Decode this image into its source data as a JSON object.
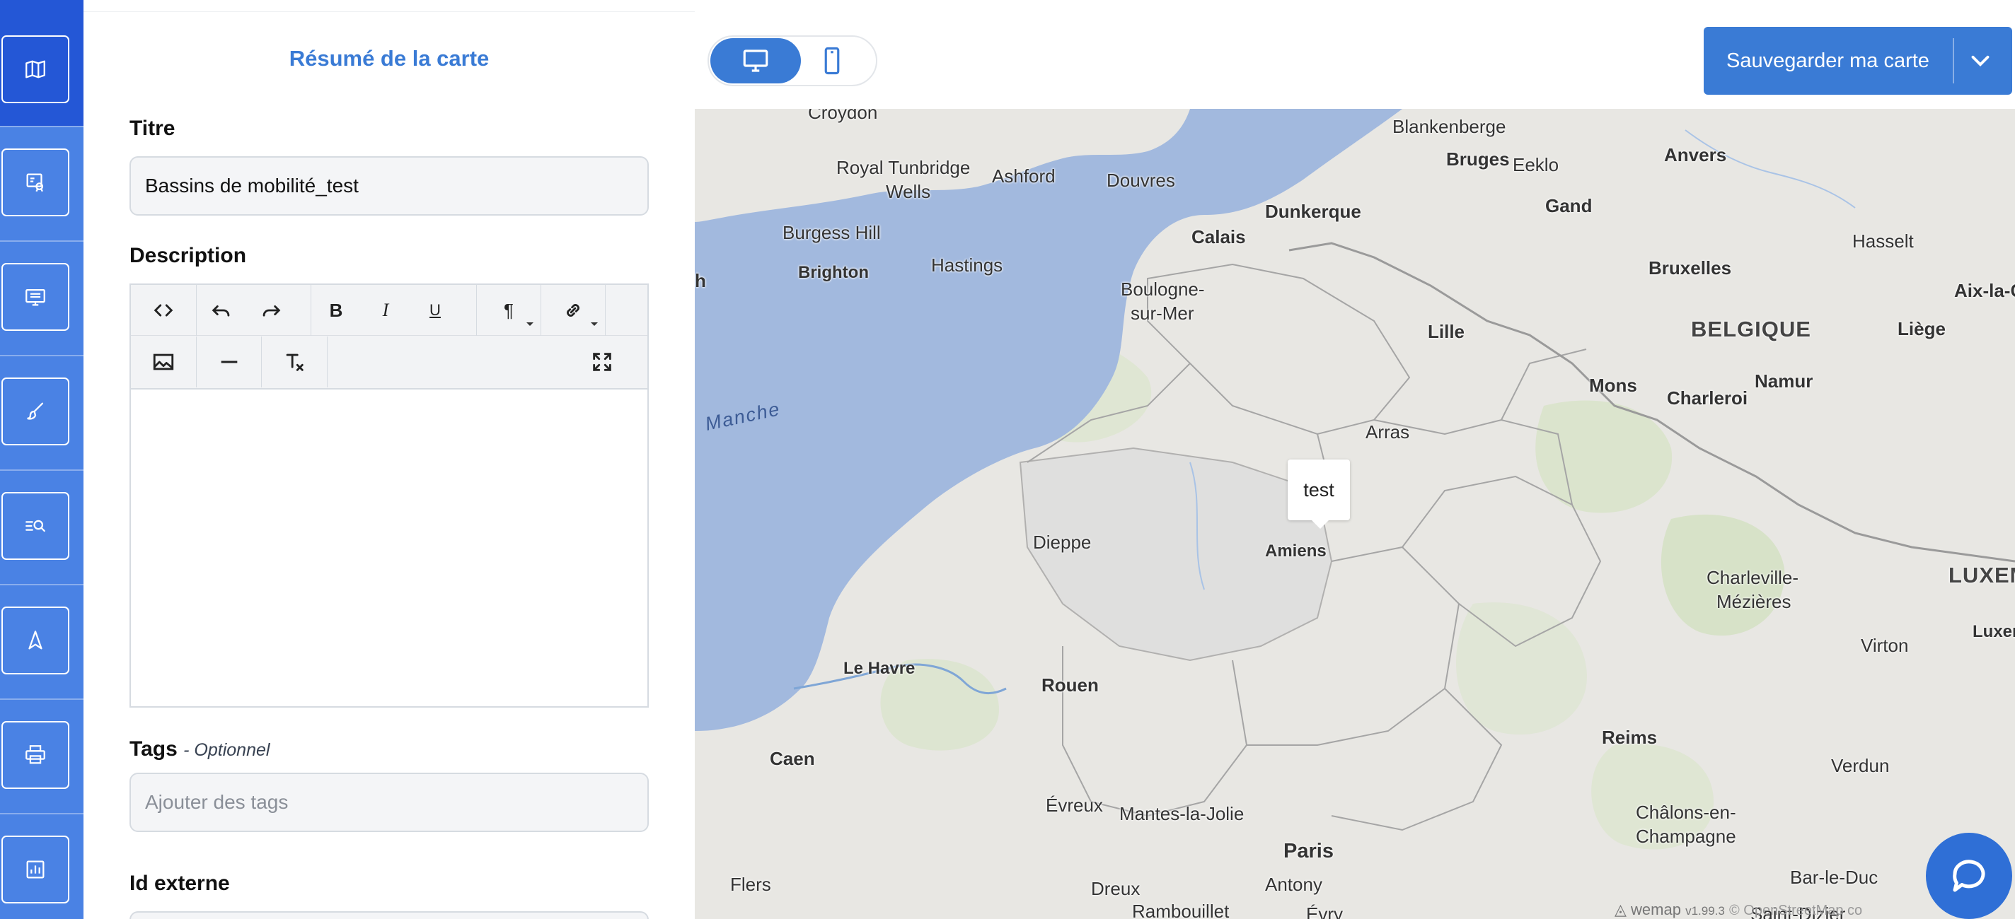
{
  "rail": {
    "items": [
      {
        "icon": "map-icon"
      },
      {
        "icon": "layers-link-icon"
      },
      {
        "icon": "display-icon"
      },
      {
        "icon": "brush-icon"
      },
      {
        "icon": "list-search-icon"
      },
      {
        "icon": "navigation-icon"
      },
      {
        "icon": "print-icon"
      },
      {
        "icon": "chart-icon"
      }
    ]
  },
  "panel": {
    "title": "Résumé de la carte",
    "title_label": "Titre",
    "title_value": "Bassins de mobilité_test",
    "description_label": "Description",
    "tags_label": "Tags",
    "tags_optional": "- Optionnel",
    "tags_placeholder": "Ajouter des tags",
    "external_id_label": "Id externe"
  },
  "editor": {
    "toolbar": {
      "bold": "B",
      "italic": "I",
      "underline": "U",
      "paragraph": "¶"
    },
    "content": ""
  },
  "topbar": {
    "save_label": "Sauvegarder ma carte",
    "device_active": "desktop"
  },
  "map": {
    "popup_text": "test",
    "attribution_brand": "wemap",
    "attribution_version": "v1.99.3",
    "attribution_osm": "© OpenStreetMap co",
    "labels": {
      "croydon": "Croydon",
      "royal_tunbridge": "Royal Tunbridge",
      "wells": "Wells",
      "ashford": "Ashford",
      "douvres": "Douvres",
      "burgess_hill": "Burgess Hill",
      "brighton": "Brighton",
      "hastings": "Hastings",
      "h_cut": "h",
      "blankenberge": "Blankenberge",
      "bruges": "Bruges",
      "eeklo": "Eeklo",
      "anvers": "Anvers",
      "dunkerque": "Dunkerque",
      "calais": "Calais",
      "gand": "Gand",
      "hasselt": "Hasselt",
      "bruxelles": "Bruxelles",
      "aix": "Aix-la-C",
      "boulogne1": "Boulogne-",
      "boulogne2": "sur-Mer",
      "lille": "Lille",
      "belgique": "BELGIQUE",
      "liege": "Liège",
      "mons": "Mons",
      "namur": "Namur",
      "charleroi": "Charleroi",
      "manche": "Manche",
      "arras": "Arras",
      "dieppe": "Dieppe",
      "amiens": "Amiens",
      "charleville1": "Charleville-",
      "charleville2": "Mézières",
      "luxem": "LUXEM",
      "luxem2": "Luxem",
      "le_havre": "Le Havre",
      "rouen": "Rouen",
      "virton": "Virton",
      "caen": "Caen",
      "reims": "Reims",
      "verdun": "Verdun",
      "evreux": "Évreux",
      "mantes": "Mantes-la-Jolie",
      "chalons1": "Châlons-en-",
      "chalons2": "Champagne",
      "paris": "Paris",
      "flers": "Flers",
      "dreux": "Dreux",
      "antony": "Antony",
      "bar_le_duc": "Bar-le-Duc",
      "rambouillet": "Rambouillet",
      "evry": "Évry",
      "saint_dizier": "Saint-Dizier"
    }
  }
}
